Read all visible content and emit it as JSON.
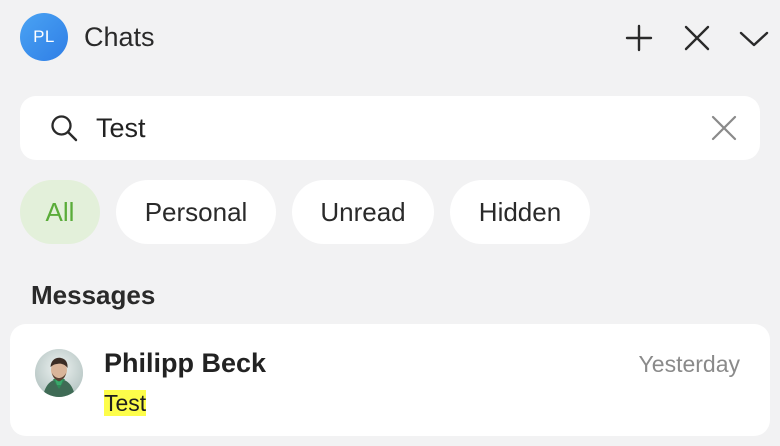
{
  "header": {
    "avatar_initials": "PL",
    "title": "Chats",
    "new_chat_icon": "plus-icon",
    "close_icon": "close-icon",
    "collapse_icon": "chevron-down-icon"
  },
  "search": {
    "value": "Test",
    "placeholder": "",
    "icon": "search-icon",
    "clear_icon": "clear-icon"
  },
  "filters": [
    {
      "label": "All",
      "active": true
    },
    {
      "label": "Personal",
      "active": false
    },
    {
      "label": "Unread",
      "active": false
    },
    {
      "label": "Hidden",
      "active": false
    }
  ],
  "messages_section": {
    "title": "Messages",
    "items": [
      {
        "sender": "Philipp Beck",
        "time": "Yesterday",
        "snippet": "Test"
      }
    ]
  },
  "colors": {
    "accent_green": "#5aac39",
    "active_chip_bg": "#e3f0da",
    "avatar_blue": "#3b8ff0",
    "highlight": "#fdfd4a",
    "background": "#f2f2f3"
  }
}
